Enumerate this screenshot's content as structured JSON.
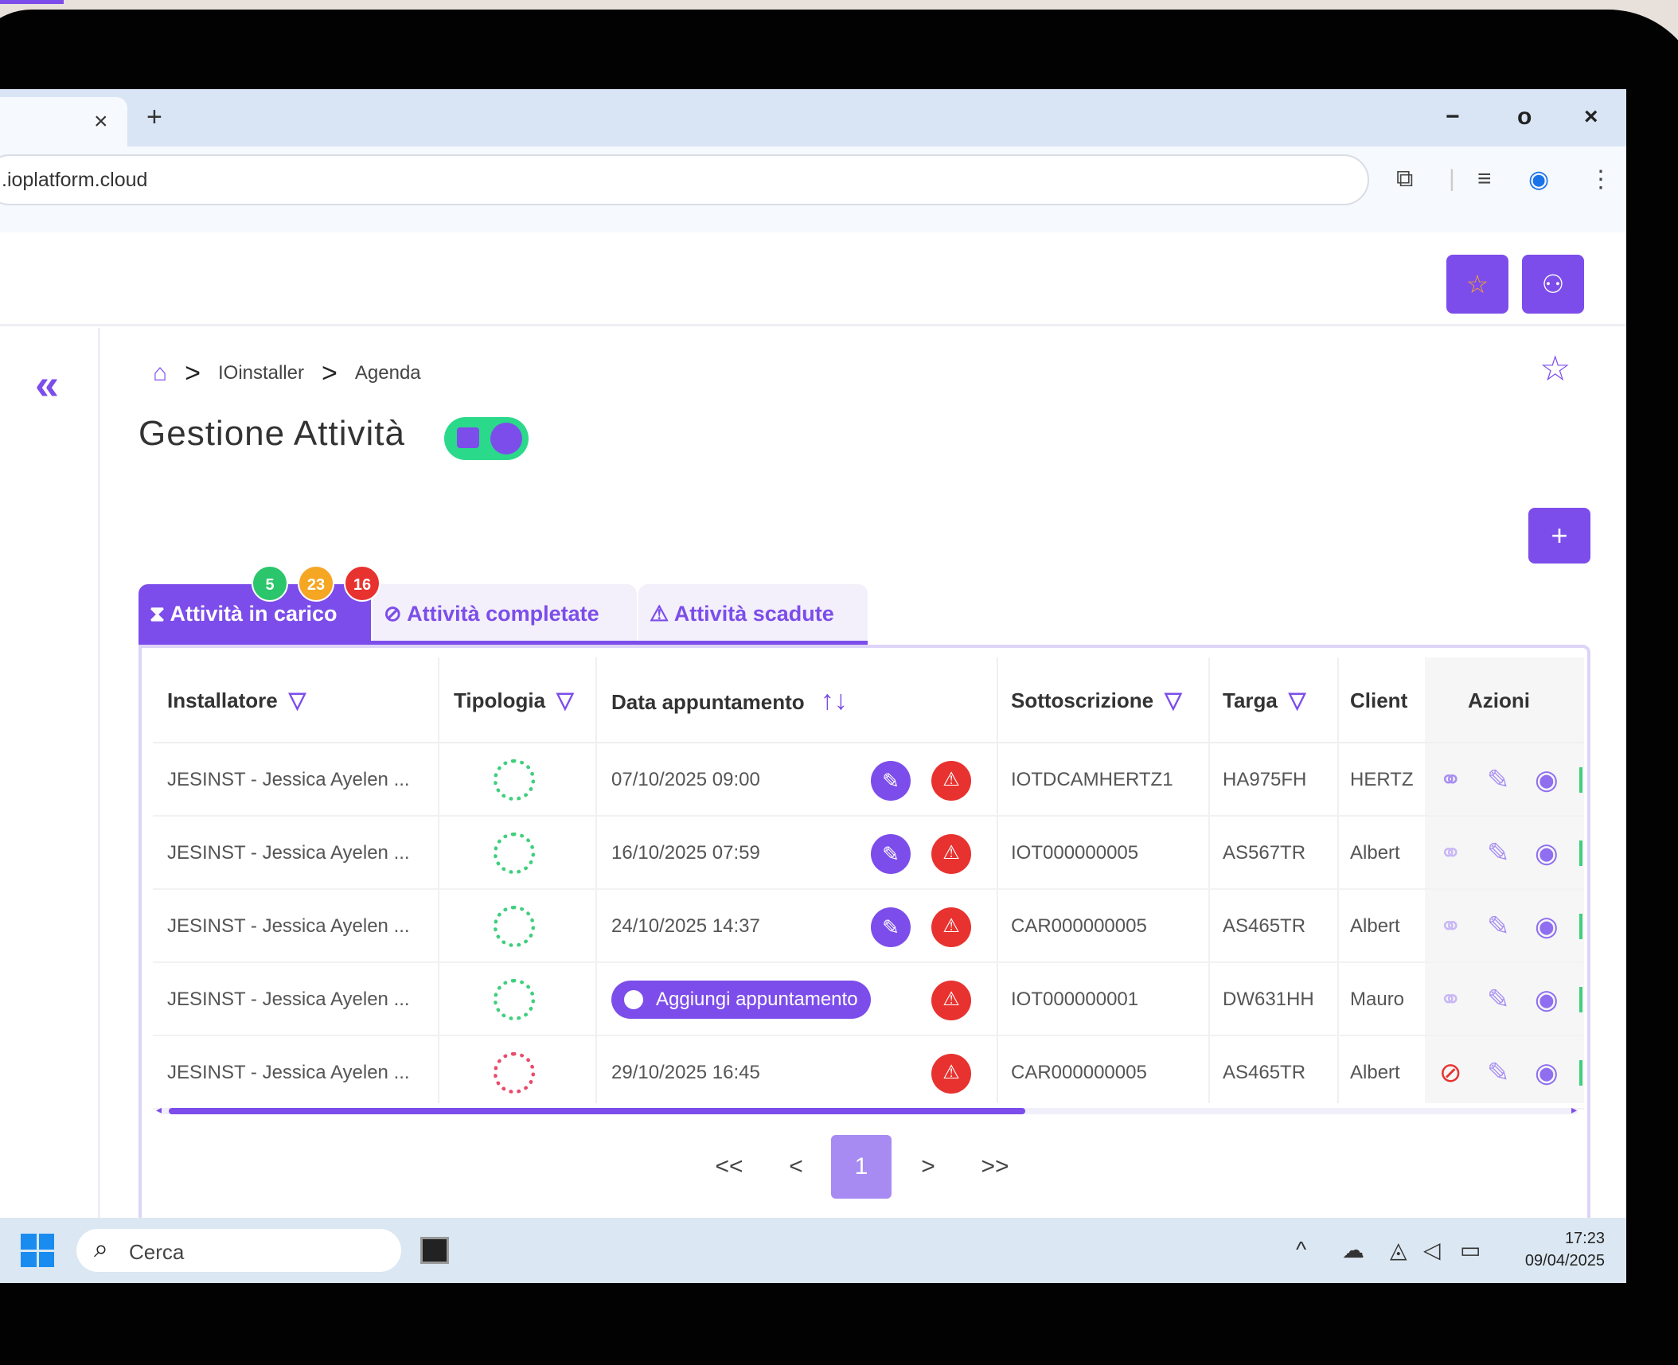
{
  "browser": {
    "tab_close": "×",
    "tab_new": "+",
    "url": ".ioplatform.cloud",
    "window_controls": {
      "minimize": "−",
      "restore": "o",
      "close": "×"
    }
  },
  "app_header": {
    "favorites_icon": "star-icon",
    "user_icon": "user-icon"
  },
  "sidebar": {
    "collapse_icon": "«"
  },
  "breadcrumb": {
    "items": [
      "IOinstaller",
      "Agenda"
    ],
    "separator": ">"
  },
  "page": {
    "title": "Gestione Attività",
    "add_label": "+"
  },
  "tabs": [
    {
      "label": "⧗ Attività in carico",
      "active": true
    },
    {
      "label": "⊘ Attività completate",
      "active": false
    },
    {
      "label": "⚠ Attività scadute",
      "active": false
    }
  ],
  "badges": [
    {
      "value": "5",
      "color": "#2bc56b"
    },
    {
      "value": "23",
      "color": "#f5a623"
    },
    {
      "value": "16",
      "color": "#e8322f"
    }
  ],
  "table": {
    "columns": [
      "Installatore",
      "Tipologia",
      "Data appuntamento",
      "Sottoscrizione",
      "Targa",
      "Client",
      "Azioni"
    ],
    "rows": [
      {
        "installer": "JESINST - Jessica Ayelen ...",
        "type_color": "green",
        "date": "07/10/2025 09:00",
        "subscription": "IOTDCAMHERTZ1",
        "plate": "HA975FH",
        "client": "HERTZ",
        "link_state": "link"
      },
      {
        "installer": "JESINST - Jessica Ayelen ...",
        "type_color": "green",
        "date": "16/10/2025 07:59",
        "subscription": "IOT000000005",
        "plate": "AS567TR",
        "client": "Albert",
        "link_state": "link"
      },
      {
        "installer": "JESINST - Jessica Ayelen ...",
        "type_color": "green",
        "date": "24/10/2025 14:37",
        "subscription": "CAR000000005",
        "plate": "AS465TR",
        "client": "Albert",
        "link_state": "link"
      },
      {
        "installer": "JESINST - Jessica Ayelen ...",
        "type_color": "green",
        "date": "",
        "add_appointment": "Aggiungi appuntamento",
        "subscription": "IOT000000001",
        "plate": "DW631HH",
        "client": "Mauro",
        "link_state": "link"
      },
      {
        "installer": "JESINST - Jessica Ayelen ...",
        "type_color": "red",
        "date": "29/10/2025 16:45",
        "subscription": "CAR000000005",
        "plate": "AS465TR",
        "client": "Albert",
        "link_state": "blocked"
      }
    ]
  },
  "pagination": {
    "first": "<<",
    "prev": "<",
    "current": "1",
    "next": ">",
    "last": ">>"
  },
  "taskbar": {
    "search_placeholder": "Cerca",
    "time": "17:23",
    "date": "09/04/2025"
  },
  "colors": {
    "accent": "#7c4dea",
    "success": "#2bd98a",
    "danger": "#e8322f"
  }
}
